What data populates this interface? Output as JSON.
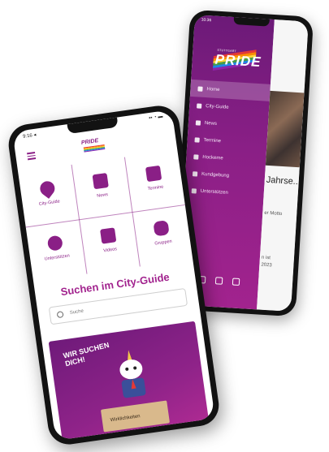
{
  "back_phone": {
    "status_time": "10:36",
    "status_signal": "▪▪▪ ◔",
    "logo_subtitle": "STUTTGART",
    "logo_word": "PRIDE",
    "menu": [
      {
        "label": "Home",
        "active": true
      },
      {
        "label": "City-Guide"
      },
      {
        "label": "News"
      },
      {
        "label": "Termine"
      },
      {
        "label": "Hockeme"
      },
      {
        "label": "Kundgebung"
      },
      {
        "label": "Unterstützen"
      }
    ],
    "headline": "Jahrse..",
    "sub1": "er Motto",
    "sub2_line1": "n ist",
    "sub2_line2": "2023"
  },
  "front_phone": {
    "status_time": "9:16 ◂",
    "status_icons": "▪▪ ◔ ▬",
    "logo_word": "PRIDE",
    "tiles": [
      {
        "label": "City-Guide"
      },
      {
        "label": "News"
      },
      {
        "label": "Termine"
      },
      {
        "label": "Unterstützen"
      },
      {
        "label": "Videos"
      },
      {
        "label": "Gruppen"
      }
    ],
    "search_title": "Suchen im City-Guide",
    "search_placeholder": "Suche",
    "banner_text": "WIR SUCHEN DICH!",
    "banner_desk_label": "Wirklichkeiten"
  },
  "colors": {
    "brand": "#8a1f86",
    "brand_light": "#a2238e",
    "pride_stripes": [
      "#e53935",
      "#fb8c00",
      "#fdd835",
      "#43a047",
      "#1e88e5",
      "#8e24aa"
    ]
  }
}
